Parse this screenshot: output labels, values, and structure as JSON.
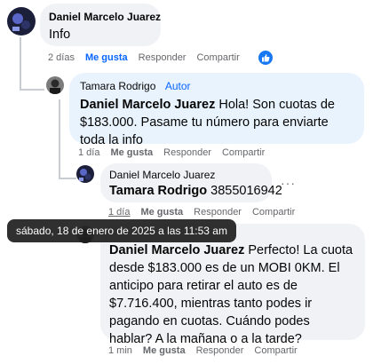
{
  "comments": [
    {
      "author": "Daniel Marcelo Juarez",
      "text": "Info",
      "time": "2 días",
      "like_label": "Me gusta",
      "reply_label": "Responder",
      "share_label": "Compartir"
    },
    {
      "author": "Tamara Rodrigo",
      "author_tag": "Autor",
      "mention": "Daniel Marcelo Juarez",
      "text": "Hola! Son cuotas de $183.000. Pasame tu número para enviarte toda la info",
      "time": "1 día",
      "like_label": "Me gusta",
      "reply_label": "Responder",
      "share_label": "Compartir"
    },
    {
      "author": "Daniel Marcelo Juarez",
      "mention": "Tamara Rodrigo",
      "text": "3855016942",
      "time": "1 día",
      "like_label": "Me gusta",
      "reply_label": "Responder",
      "share_label": "Compartir",
      "more_label": "···"
    },
    {
      "mention": "Daniel Marcelo Juarez",
      "text": "Perfecto! La cuota desde $183.000 es de un MOBI 0KM. El anticipo para retirar el auto es de $7.716.400, mientras tanto podes ir pagando en cuotas. Cuándo podes hablar? A la mañana o a la tarde?",
      "time": "1 min",
      "like_label": "Me gusta",
      "reply_label": "Responder",
      "share_label": "Compartir"
    }
  ],
  "tooltip": "sábado, 18 de enero de 2025 a las 11:53 am",
  "colors": {
    "link_blue": "#0866ff",
    "bubble_grey": "#f0f2f5",
    "author_bubble": "#e9f3fd",
    "meta_grey": "#65676b"
  },
  "icons": {
    "like_reaction": "thumbs-up-icon"
  }
}
